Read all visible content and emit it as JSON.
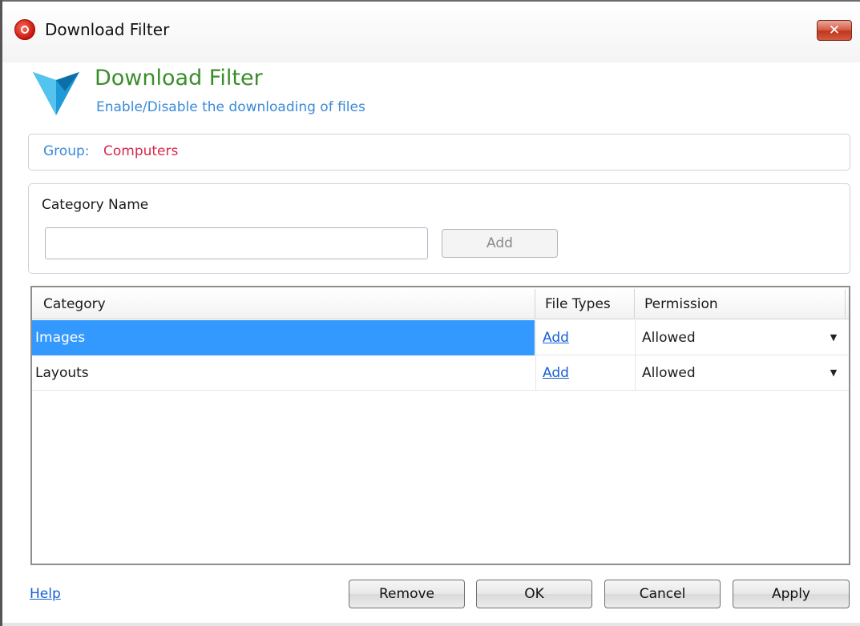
{
  "window": {
    "title": "Download Filter",
    "close_glyph": "✕"
  },
  "header": {
    "title": "Download Filter",
    "subtitle": "Enable/Disable the downloading  of files"
  },
  "group": {
    "label": "Group:",
    "value": "Computers"
  },
  "category_form": {
    "label": "Category Name",
    "input_value": "",
    "add_label": "Add"
  },
  "grid": {
    "columns": [
      "Category",
      "File Types",
      "Permission"
    ],
    "rows": [
      {
        "category": "Images",
        "file_types": "Add",
        "permission": "Allowed",
        "selected": true
      },
      {
        "category": "Layouts",
        "file_types": "Add",
        "permission": "Allowed",
        "selected": false
      }
    ]
  },
  "footer": {
    "help": "Help",
    "remove": "Remove",
    "ok": "OK",
    "cancel": "Cancel",
    "apply": "Apply"
  },
  "icons": {
    "app": "app-icon",
    "logo": "download-filter-logo-icon",
    "dropdown": "chevron-down-icon"
  },
  "colors": {
    "accent_green": "#3a8e2a",
    "accent_blue": "#3a8ad8",
    "group_value_red": "#d8284a",
    "selection": "#3399ff",
    "link": "#1560d6"
  }
}
